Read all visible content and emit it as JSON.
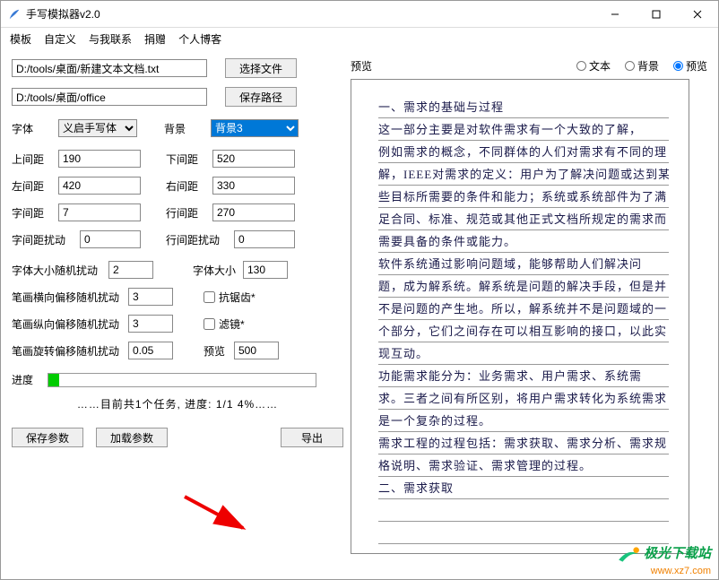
{
  "window": {
    "title": "手写模拟器v2.0",
    "minimize": "—",
    "maximize": "☐",
    "close": "✕"
  },
  "menu": {
    "template": "模板",
    "custom": "自定义",
    "contact": "与我联系",
    "donate": "捐赠",
    "blog": "个人博客"
  },
  "file": {
    "source": "D:/tools/桌面/新建文本文档.txt",
    "dest": "D:/tools/桌面/office",
    "choose": "选择文件",
    "savepath": "保存路径"
  },
  "font": {
    "label": "字体",
    "value": "义启手写体",
    "bglabel": "背景",
    "bgvalue": "背景3"
  },
  "params": {
    "top_label": "上间距",
    "top": "190",
    "bottom_label": "下间距",
    "bottom": "520",
    "left_label": "左间距",
    "left": "420",
    "right_label": "右间距",
    "right": "330",
    "char_label": "字间距",
    "char": "7",
    "line_label": "行间距",
    "line": "270",
    "charrand_label": "字间距扰动",
    "charrand": "0",
    "linerand_label": "行间距扰动",
    "linerand": "0",
    "sizerand_label": "字体大小随机扰动",
    "sizerand": "2",
    "size_label": "字体大小",
    "size": "130",
    "stroke_h_label": "笔画横向偏移随机扰动",
    "stroke_h": "3",
    "aa_label": "抗锯齿*",
    "stroke_v_label": "笔画纵向偏移随机扰动",
    "stroke_v": "3",
    "filter_label": "滤镜*",
    "stroke_r_label": "笔画旋转偏移随机扰动",
    "stroke_r": "0.05",
    "preview_label": "预览",
    "preview": "500"
  },
  "progress": {
    "label": "进度",
    "percent": 4,
    "status": "……目前共1个任务, 进度: 1/1 4%……"
  },
  "buttons": {
    "saveparam": "保存参数",
    "loadparam": "加载参数",
    "export": "导出"
  },
  "previewpane": {
    "title": "预览",
    "r_text": "文本",
    "r_bg": "背景",
    "r_preview": "预览"
  },
  "handwriting": [
    "一、需求的基础与过程",
    "这一部分主要是对软件需求有一个大致的了解，",
    "例如需求的概念，不同群体的人们对需求有不同的理",
    "解，IEEE对需求的定义：用户为了解决问题或达到某",
    "些目标所需要的条件和能力；系统或系统部件为了满",
    "足合同、标准、规范或其他正式文档所规定的需求而",
    "需要具备的条件或能力。",
    "    软件系统通过影响问题域，能够帮助人们解决问",
    "题，成为解系统。解系统是问题的解决手段，但是并",
    "不是问题的产生地。所以，解系统并不是问题域的一",
    "个部分，它们之间存在可以相互影响的接口，以此实",
    "现互动。",
    "    功能需求能分为：业务需求、用户需求、系统需",
    "求。三者之间有所区别，将用户需求转化为系统需求",
    "是一个复杂的过程。",
    "需求工程的过程包括：需求获取、需求分析、需求规",
    "格说明、需求验证、需求管理的过程。",
    "二、需求获取",
    "",
    ""
  ],
  "watermark": {
    "line1": "极光下载站",
    "line2": "www.xz7.com"
  }
}
